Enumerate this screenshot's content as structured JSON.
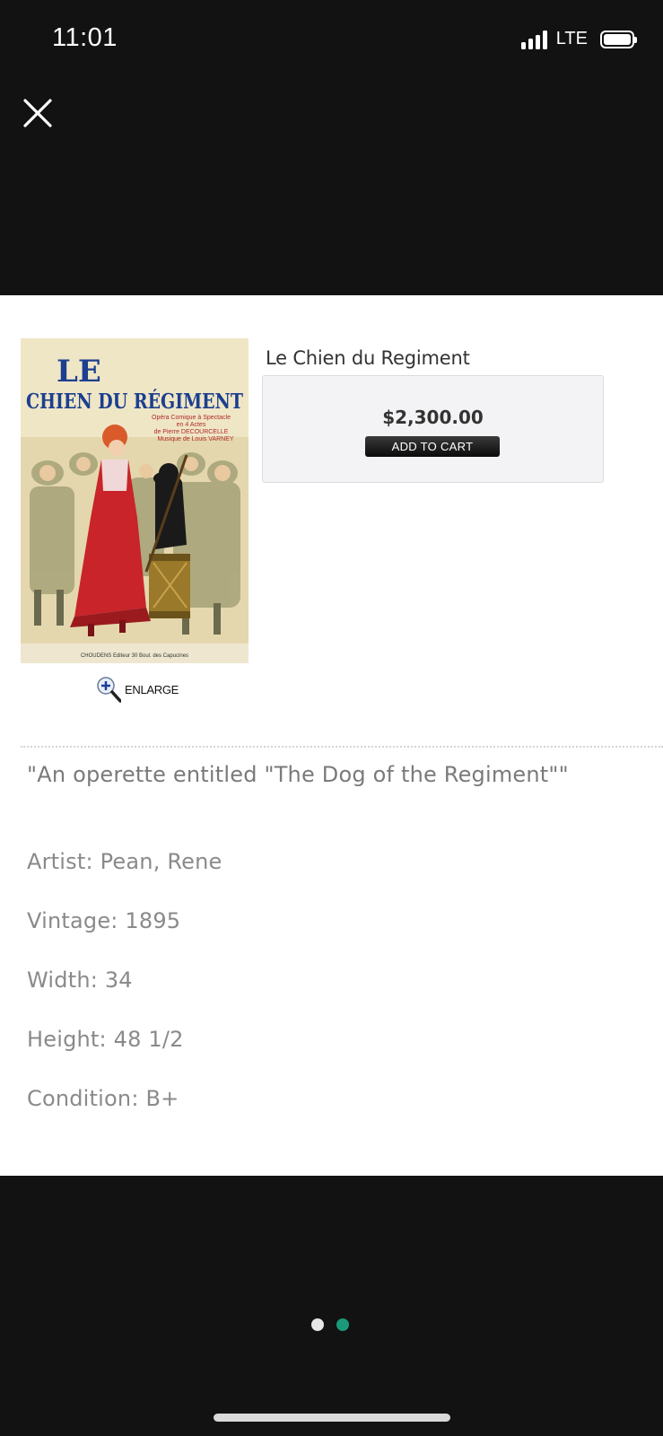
{
  "status_bar": {
    "time": "11:01",
    "network": "LTE",
    "signal_bars": 4,
    "battery_level": 1.0
  },
  "close_button": {
    "icon": "close-icon",
    "color": "#ffffff"
  },
  "product": {
    "title": "Le Chien du Regiment",
    "price": "$2,300.00",
    "add_to_cart_label": "ADD TO CART",
    "enlarge_label": "ENLARGE",
    "image": {
      "title_line1": "LE",
      "title_line2": "CHIEN DU RÉGIMENT",
      "subtitle_lines": [
        "Opéra Comique à Spectacle",
        "en 4 Actes",
        "de Pierre DECOURCELLE",
        "Musique de Louis VARNEY"
      ],
      "printer": "CHOUDENS Editeur 30 Boul. des Capucines"
    },
    "description": "\"An operette entitled \"The Dog of the Regiment\"\"",
    "specs": [
      {
        "text": "Artist: Pean, Rene"
      },
      {
        "text": "Vintage: 1895"
      },
      {
        "text": "Width: 34"
      },
      {
        "text": "Height: 48 1/2"
      },
      {
        "text": "Condition: B+"
      }
    ]
  },
  "pagination": {
    "total": 2,
    "active_index": 1,
    "active_color": "#1a9a7a",
    "inactive_color": "#e6e6e6"
  },
  "colors": {
    "background": "#121212",
    "card": "#ffffff",
    "price_box": "#f3f3f5"
  }
}
